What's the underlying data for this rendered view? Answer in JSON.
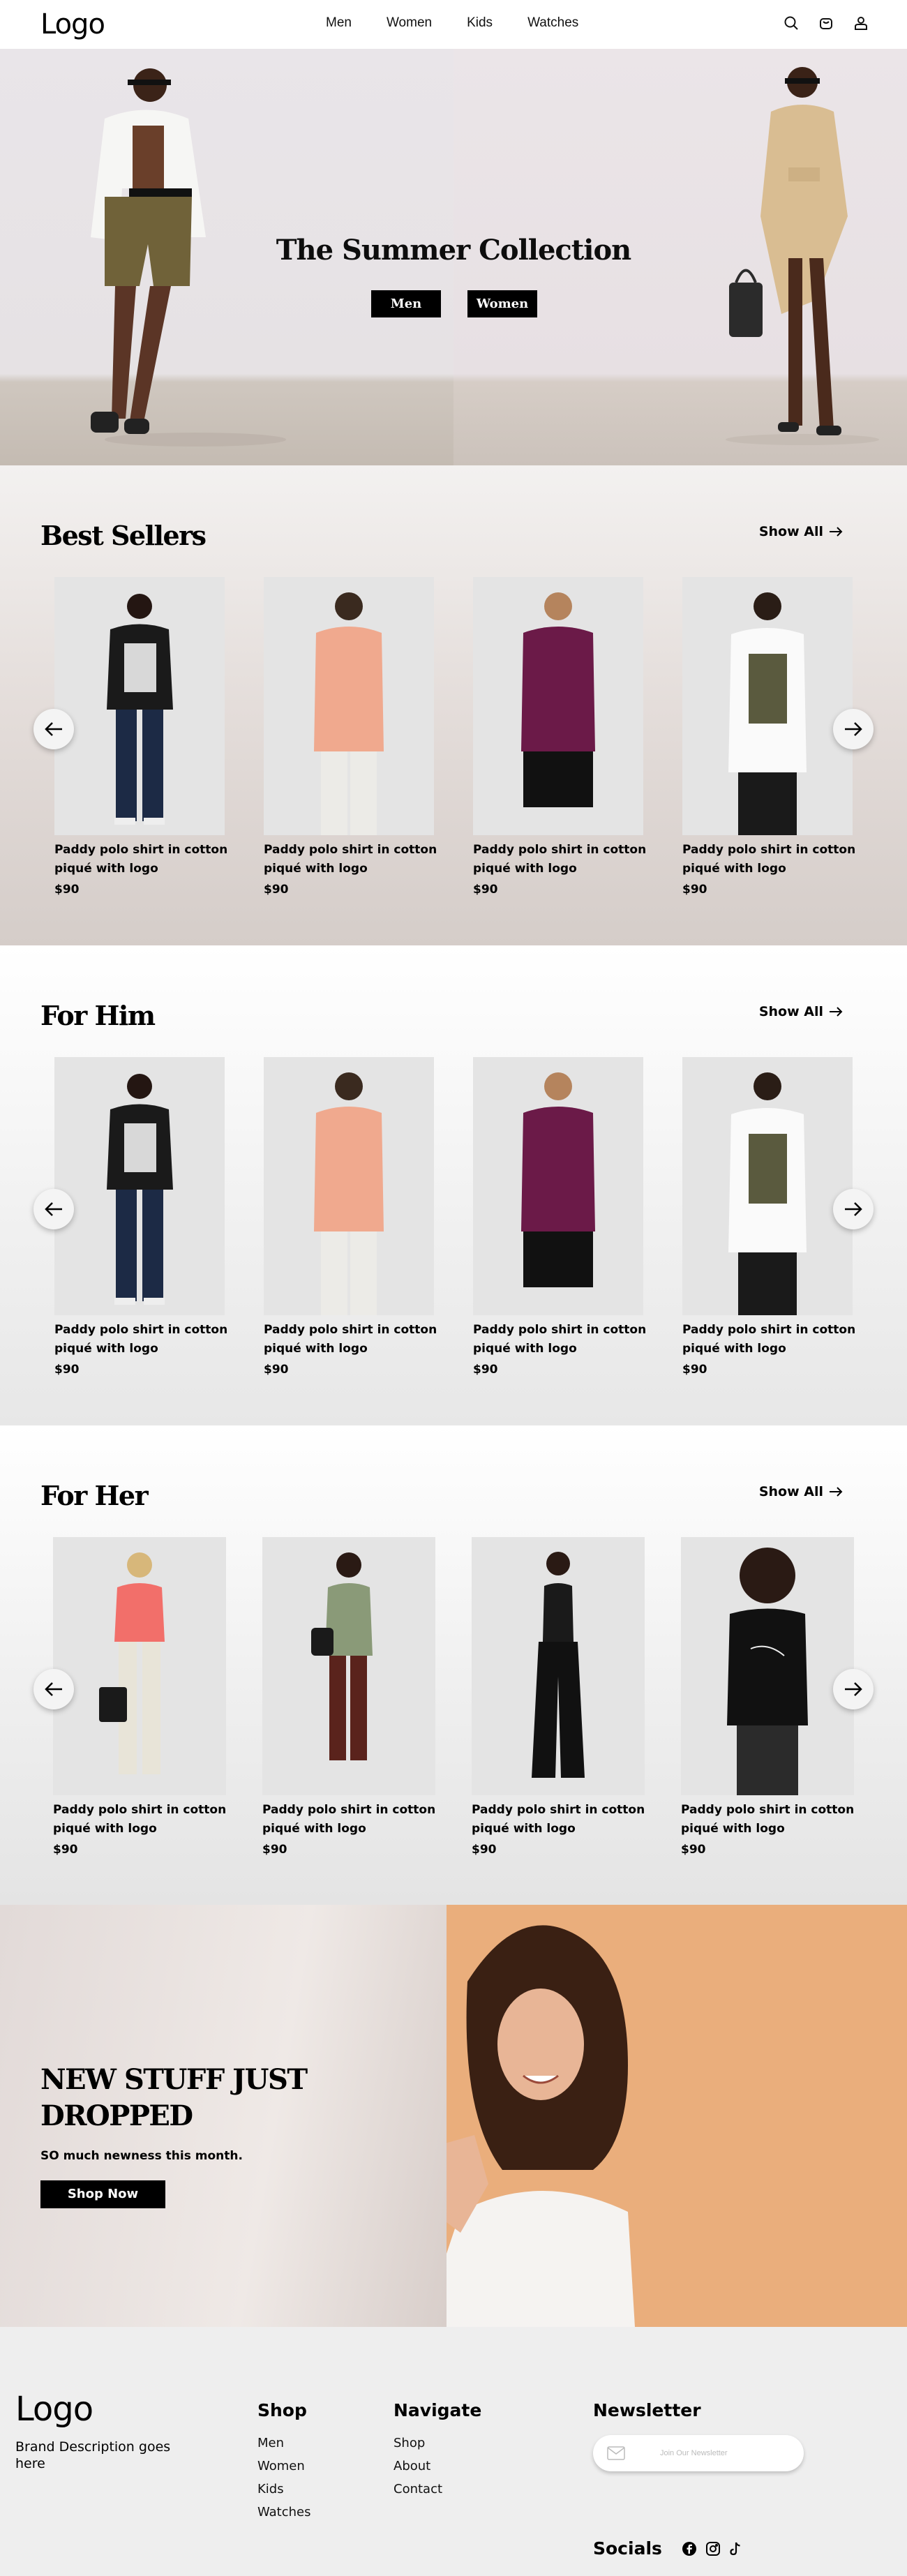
{
  "header": {
    "logo": "Logo",
    "nav": [
      "Men",
      "Women",
      "Kids",
      "Watches"
    ],
    "icons": [
      "search-icon",
      "bag-icon",
      "user-icon"
    ]
  },
  "hero": {
    "title": "The Summer Collection",
    "men_button": "Men",
    "women_button": "Women"
  },
  "best_sellers": {
    "title": "Best Sellers",
    "show_all": "Show All",
    "products": [
      {
        "name": "Paddy polo shirt in cotton piqué with logo",
        "price": "$90"
      },
      {
        "name": "Paddy polo shirt in cotton piqué with logo",
        "price": "$90"
      },
      {
        "name": "Paddy polo shirt in cotton piqué with logo",
        "price": "$90"
      },
      {
        "name": "Paddy polo shirt in cotton piqué with logo",
        "price": "$90"
      }
    ]
  },
  "for_him": {
    "title": "For Him",
    "show_all": "Show All",
    "products": [
      {
        "name": "Paddy polo shirt in cotton piqué with logo",
        "price": "$90"
      },
      {
        "name": "Paddy polo shirt in cotton piqué with logo",
        "price": "$90"
      },
      {
        "name": "Paddy polo shirt in cotton piqué with logo",
        "price": "$90"
      },
      {
        "name": "Paddy polo shirt in cotton piqué with logo",
        "price": "$90"
      }
    ]
  },
  "for_her": {
    "title": "For Her",
    "show_all": "Show All",
    "products": [
      {
        "name": "Paddy polo shirt in cotton piqué with logo",
        "price": "$90"
      },
      {
        "name": "Paddy polo shirt in cotton piqué with logo",
        "price": "$90"
      },
      {
        "name": "Paddy polo shirt in cotton piqué with logo",
        "price": "$90"
      },
      {
        "name": "Paddy polo shirt in cotton piqué with logo",
        "price": "$90"
      }
    ]
  },
  "promo": {
    "title": "NEW STUFF JUST DROPPED",
    "subtitle": "SO much newness this month.",
    "button": "Shop Now"
  },
  "footer": {
    "logo": "Logo",
    "description": "Brand Description goes here",
    "shop": {
      "title": "Shop",
      "links": [
        "Men",
        "Women",
        "Kids",
        "Watches"
      ]
    },
    "navigate": {
      "title": "Navigate",
      "links": [
        "Shop",
        "About",
        "Contact"
      ]
    },
    "newsletter": {
      "title": "Newsletter",
      "placeholder": "Join Our Newsletter"
    },
    "socials": {
      "title": "Socials",
      "icons": [
        "facebook-icon",
        "instagram-icon",
        "tiktok-icon"
      ]
    }
  },
  "colors": {
    "accent": "#000000",
    "promo_bg": "#eaae7c",
    "footer_bg": "#eeeeee"
  }
}
